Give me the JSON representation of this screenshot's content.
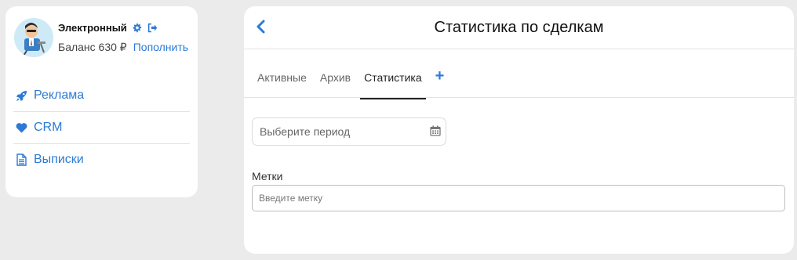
{
  "user": {
    "name": "Электронный",
    "balance_label": "Баланс 630 ₽",
    "topup_label": "Пополнить"
  },
  "sidebar": {
    "items": [
      {
        "label": "Реклама",
        "icon": "rocket-icon"
      },
      {
        "label": "CRM",
        "icon": "heart-icon"
      },
      {
        "label": "Выписки",
        "icon": "document-icon"
      }
    ]
  },
  "main": {
    "title": "Статистика по сделкам",
    "tabs": [
      {
        "label": "Активные"
      },
      {
        "label": "Архив"
      },
      {
        "label": "Статистика",
        "active": true
      }
    ],
    "add_tab_label": "+",
    "period_placeholder": "Выберите период",
    "tags_label": "Метки",
    "tags_placeholder": "Введите метку"
  },
  "colors": {
    "accent": "#2b7bd6",
    "background": "#ebebeb",
    "card": "#ffffff"
  }
}
